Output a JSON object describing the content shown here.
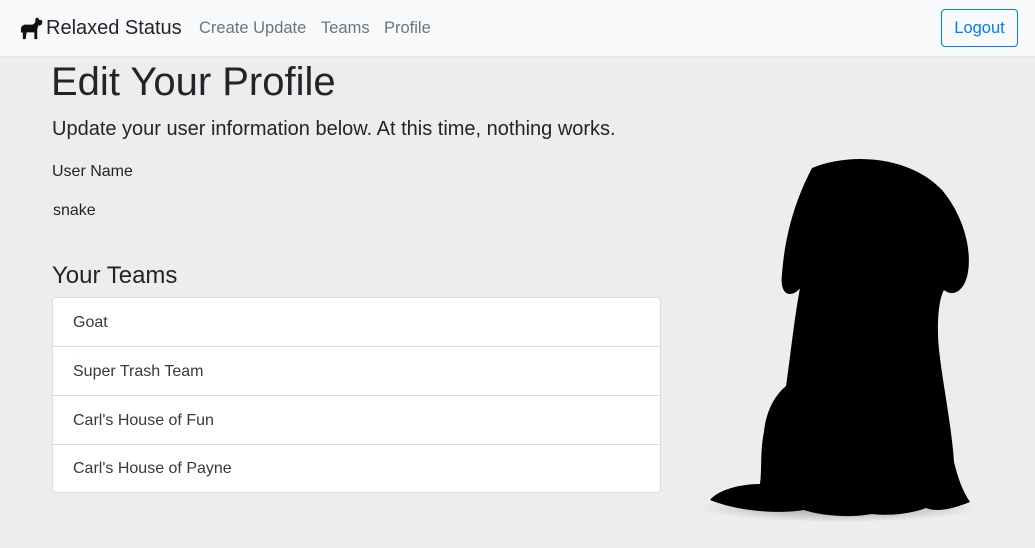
{
  "navbar": {
    "brand_label": "Relaxed Status",
    "brand_icon": "dog-icon",
    "links": [
      {
        "label": "Create Update"
      },
      {
        "label": "Teams"
      },
      {
        "label": "Profile"
      }
    ],
    "logout_label": "Logout"
  },
  "main": {
    "title": "Edit Your Profile",
    "lead": "Update your user information below. At this time, nothing works.",
    "user_name_label": "User Name",
    "user_name_value": "snake",
    "teams_title": "Your Teams",
    "teams": [
      {
        "name": "Goat"
      },
      {
        "name": "Super Trash Team"
      },
      {
        "name": "Carl's House of Fun"
      },
      {
        "name": "Carl's House of Payne"
      }
    ]
  },
  "illustration": "dog-silhouette",
  "colors": {
    "accent": "#007bff",
    "nav_background": "#f8f9fa",
    "page_background": "#ededed"
  }
}
